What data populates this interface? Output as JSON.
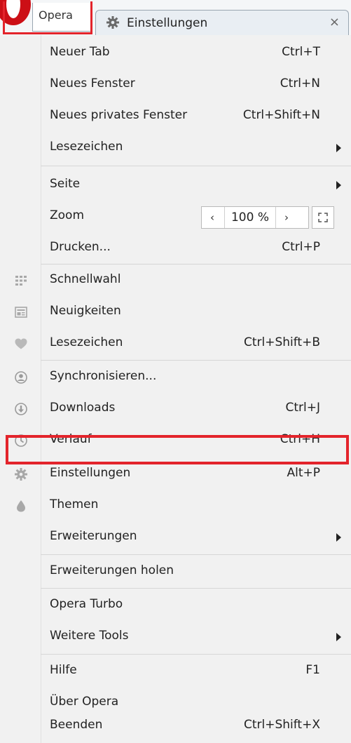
{
  "tabbar": {
    "opera_button_label": "Opera",
    "tab_title": "Einstellungen",
    "close_glyph": "×",
    "brand_color": "#cc0f16",
    "highlight_color": "#e3242b"
  },
  "menu": {
    "items": [
      {
        "label": "Neuer Tab",
        "shortcut": "Ctrl+T"
      },
      {
        "label": "Neues Fenster",
        "shortcut": "Ctrl+N"
      },
      {
        "label": "Neues privates Fenster",
        "shortcut": "Ctrl+Shift+N"
      },
      {
        "label": "Lesezeichen",
        "submenu": true
      },
      {
        "label": "Seite",
        "submenu": true
      },
      {
        "label": "Zoom",
        "zoom_value": "100 %"
      },
      {
        "label": "Drucken...",
        "shortcut": "Ctrl+P"
      },
      {
        "label": "Schnellwahl",
        "icon": "speed-dial-icon"
      },
      {
        "label": "Neuigkeiten",
        "icon": "news-icon"
      },
      {
        "label": "Lesezeichen",
        "shortcut": "Ctrl+Shift+B",
        "icon": "heart-icon"
      },
      {
        "label": "Synchronisieren...",
        "icon": "sync-user-icon"
      },
      {
        "label": "Downloads",
        "shortcut": "Ctrl+J",
        "icon": "download-icon"
      },
      {
        "label": "Verlauf",
        "shortcut": "Ctrl+H",
        "icon": "clock-icon"
      },
      {
        "label": "Einstellungen",
        "shortcut": "Alt+P",
        "icon": "gear-icon",
        "highlighted": true
      },
      {
        "label": "Themen",
        "icon": "drop-icon"
      },
      {
        "label": "Erweiterungen",
        "submenu": true
      },
      {
        "label": "Erweiterungen holen"
      },
      {
        "label": "Opera Turbo"
      },
      {
        "label": "Weitere Tools",
        "submenu": true
      },
      {
        "label": "Hilfe",
        "shortcut": "F1"
      },
      {
        "label": "Über Opera"
      },
      {
        "label": "Beenden",
        "shortcut": "Ctrl+Shift+X"
      }
    ]
  }
}
